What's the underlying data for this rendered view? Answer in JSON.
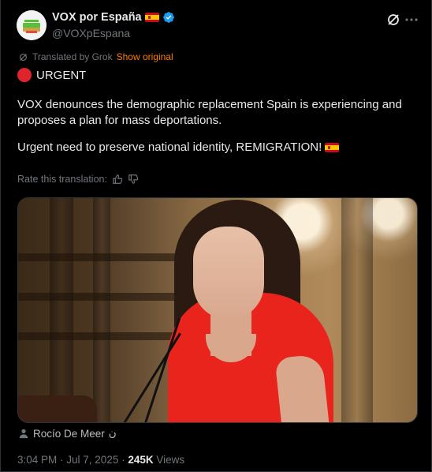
{
  "author": {
    "display_name": "VOX por España",
    "handle": "@VOXpEspana",
    "verified": true,
    "flag": "spain-flag"
  },
  "translation": {
    "notice": "Translated by Grok",
    "show_original": "Show original",
    "rate_label": "Rate this translation:"
  },
  "post": {
    "urgent_label": "URGENT",
    "paragraph1": "VOX denounces the demographic replacement Spain is experiencing and proposes a plan for mass deportations.",
    "paragraph2": "Urgent need to preserve national identity, REMIGRATION!"
  },
  "media": {
    "tagged_person": "Rocío De Meer",
    "tag_suffix": "ن"
  },
  "meta": {
    "time": "3:04 PM",
    "separator": " · ",
    "date": "Jul 7, 2025",
    "views_count": "245K",
    "views_label": " Views"
  },
  "colors": {
    "background": "#000000",
    "text": "#e7e9ea",
    "muted": "#71767b",
    "accent_orange": "#ff7a00",
    "verified_blue": "#1d9bf0",
    "urgent_red": "#e0242c"
  }
}
